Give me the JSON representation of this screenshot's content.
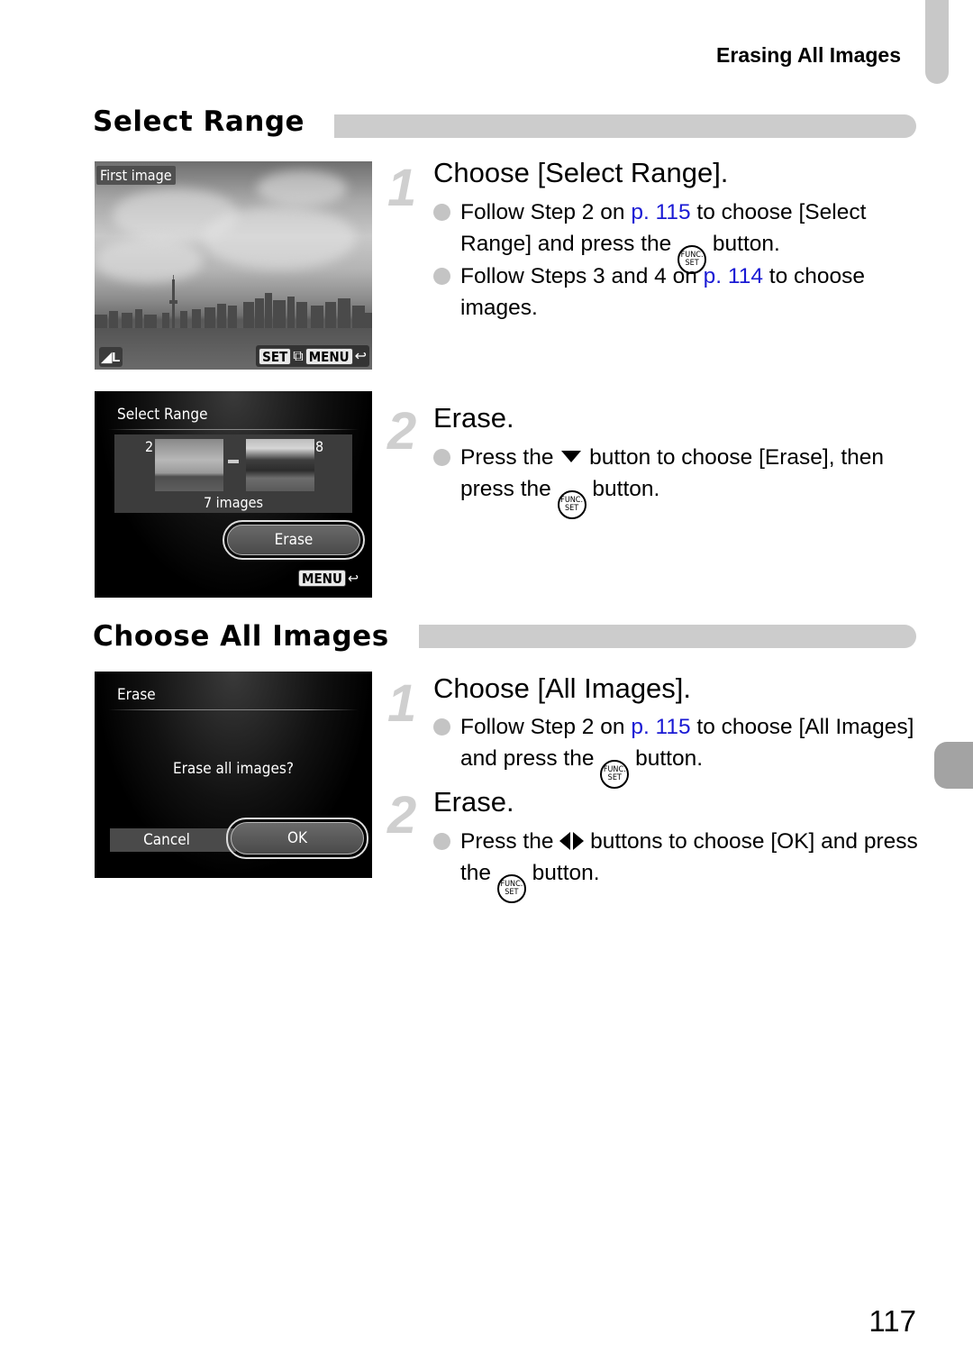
{
  "running_head": "Erasing All Images",
  "page_number": "117",
  "sections": [
    {
      "title": "Select Range",
      "screens": [
        {
          "type": "photo",
          "label": "First image",
          "size_icon": "L",
          "keys": [
            "SET",
            "MENU"
          ],
          "icons": [
            "size-large-icon",
            "set-key-icon",
            "jump-icon",
            "menu-key-icon",
            "return-arrow-icon"
          ]
        },
        {
          "type": "range",
          "title": "Select Range",
          "start_number": "2",
          "end_number": "8",
          "count": "7 images",
          "button": "Erase",
          "menu_key": "MENU"
        }
      ],
      "steps": [
        {
          "number": "1",
          "title": "Choose [Select Range].",
          "bullets": [
            {
              "pre": "Follow Step 2 on ",
              "link": "p. 115",
              "mid": " to choose [Select Range] and press the ",
              "icon": "func-set-icon",
              "post": " button."
            },
            {
              "pre": "Follow Steps 3 and 4 on ",
              "link": "p. 114",
              "post": " to choose images."
            }
          ]
        },
        {
          "number": "2",
          "title": "Erase.",
          "bullets": [
            {
              "pre": "Press the ",
              "icon1": "down-arrow-icon",
              "mid": " button to choose [Erase], then press the ",
              "icon2": "func-set-icon",
              "post": " button."
            }
          ]
        }
      ]
    },
    {
      "title": "Choose All Images",
      "screens": [
        {
          "type": "confirm",
          "title": "Erase",
          "question": "Erase all images?",
          "cancel": "Cancel",
          "ok": "OK"
        }
      ],
      "steps": [
        {
          "number": "1",
          "title": "Choose [All Images].",
          "bullets": [
            {
              "pre": "Follow Step 2 on ",
              "link": "p. 115",
              "mid": " to choose [All Images] and press the ",
              "icon": "func-set-icon",
              "post": " button."
            }
          ]
        },
        {
          "number": "2",
          "title": "Erase.",
          "bullets": [
            {
              "pre": "Press the ",
              "icon1": "left-right-arrows-icon",
              "mid": " buttons to choose [OK] and press the ",
              "icon2": "func-set-icon",
              "post": " button."
            }
          ]
        }
      ]
    }
  ],
  "func_set": {
    "top": "FUNC.",
    "bottom": "SET"
  },
  "colors": {
    "link": "#1a1ad4",
    "section_bar": "#cccccc",
    "step_number": "#cfcfcf",
    "side_tab": "#a3a3a3"
  }
}
